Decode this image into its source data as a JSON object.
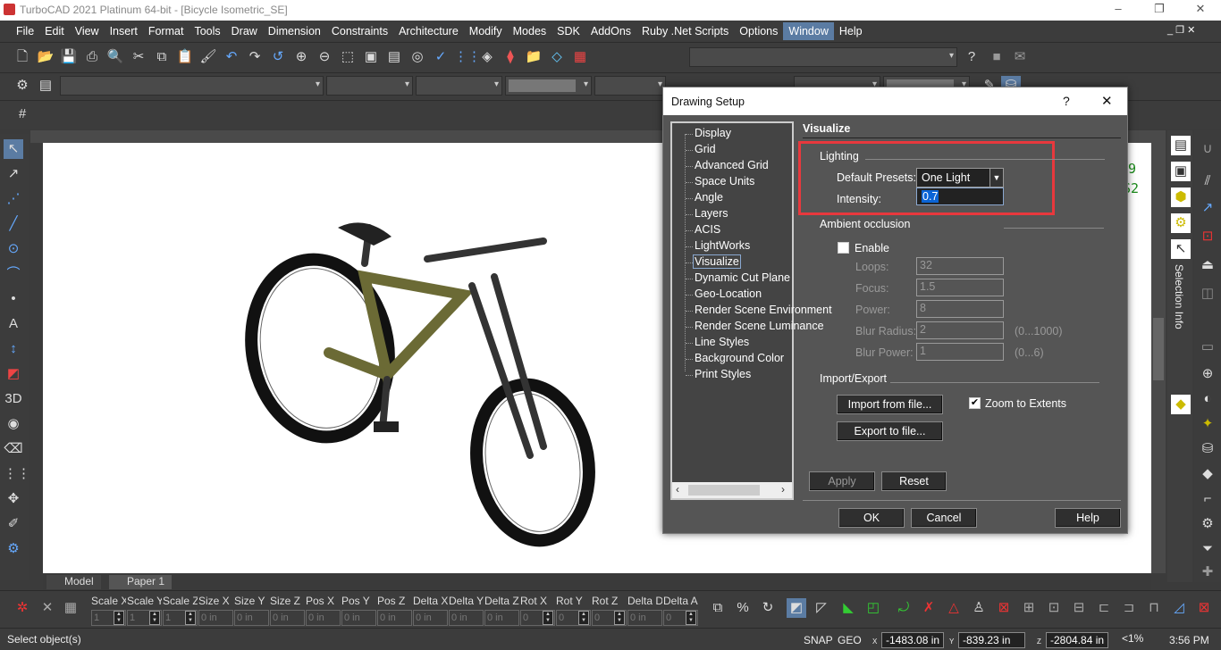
{
  "window": {
    "title": "TurboCAD 2021 Platinum 64-bit - [Bicycle Isometric_SE]",
    "minimize": "–",
    "maximize": "❐",
    "close": "✕"
  },
  "menu": [
    "File",
    "Edit",
    "View",
    "Insert",
    "Format",
    "Tools",
    "Draw",
    "Dimension",
    "Constraints",
    "Architecture",
    "Modify",
    "Modes",
    "SDK",
    "AddOns",
    "Ruby .Net Scripts",
    "Options",
    "Window",
    "Help"
  ],
  "menu_active": "Window",
  "mdi_controls": "_ ❐ ✕",
  "canvas": {
    "annotations": [
      ".9",
      "S2"
    ]
  },
  "right_panel": {
    "tab_label": "Selection Info"
  },
  "tabs": [
    "Model",
    "Paper 1"
  ],
  "inspector": {
    "fields": [
      {
        "label": "Scale X",
        "value": "1"
      },
      {
        "label": "Scale Y",
        "value": "1"
      },
      {
        "label": "Scale Z",
        "value": "1"
      },
      {
        "label": "Size X",
        "value": "0 in"
      },
      {
        "label": "Size Y",
        "value": "0 in"
      },
      {
        "label": "Size Z",
        "value": "0 in"
      },
      {
        "label": "Pos X",
        "value": "0 in"
      },
      {
        "label": "Pos Y",
        "value": "0 in"
      },
      {
        "label": "Pos Z",
        "value": "0 in"
      },
      {
        "label": "Delta X",
        "value": "0 in"
      },
      {
        "label": "Delta Y",
        "value": "0 in"
      },
      {
        "label": "Delta Z",
        "value": "0 in"
      },
      {
        "label": "Rot X",
        "value": "0"
      },
      {
        "label": "Rot Y",
        "value": "0"
      },
      {
        "label": "Rot Z",
        "value": "0"
      },
      {
        "label": "Delta D",
        "value": "0 in"
      },
      {
        "label": "Delta A",
        "value": "0"
      }
    ]
  },
  "status": {
    "prompt": "Select object(s)",
    "snap": "SNAP",
    "geo": "GEO",
    "x_label": "X",
    "x": "-1483.08 in",
    "y_label": "Y",
    "y": "-839.23 in",
    "z_label": "Z",
    "z": "-2804.84 in",
    "zoom": "<1%",
    "time": "3:56 PM"
  },
  "dialog": {
    "title": "Drawing Setup",
    "help": "?",
    "close": "✕",
    "tree": [
      "Display",
      "Grid",
      "Advanced Grid",
      "Space Units",
      "Angle",
      "Layers",
      "ACIS",
      "LightWorks",
      "Visualize",
      "Dynamic Cut Plane",
      "Geo-Location",
      "Render Scene Environment",
      "Render Scene Luminance",
      "Line Styles",
      "Background Color",
      "Print Styles"
    ],
    "tree_selected": "Visualize",
    "section": "Visualize",
    "lighting": {
      "title": "Lighting",
      "presets_label": "Default Presets:",
      "presets_value": "One Light",
      "intensity_label": "Intensity:",
      "intensity_value": "0.7"
    },
    "ambient": {
      "title": "Ambient occlusion",
      "enable_label": "Enable",
      "enabled": false,
      "fields": [
        {
          "label": "Loops:",
          "value": "32",
          "range": ""
        },
        {
          "label": "Focus:",
          "value": "1.5",
          "range": ""
        },
        {
          "label": "Power:",
          "value": "8",
          "range": ""
        },
        {
          "label": "Blur Radius:",
          "value": "2",
          "range": "(0...1000)"
        },
        {
          "label": "Blur Power:",
          "value": "1",
          "range": "(0...6)"
        }
      ]
    },
    "import_export": {
      "title": "Import/Export",
      "import": "Import from file...",
      "export": "Export to file...",
      "zoom_label": "Zoom to Extents",
      "zoom_checked": true
    },
    "apply": "Apply",
    "reset": "Reset",
    "ok": "OK",
    "cancel": "Cancel",
    "help_btn": "Help",
    "highlight_color": "#e8383d"
  }
}
